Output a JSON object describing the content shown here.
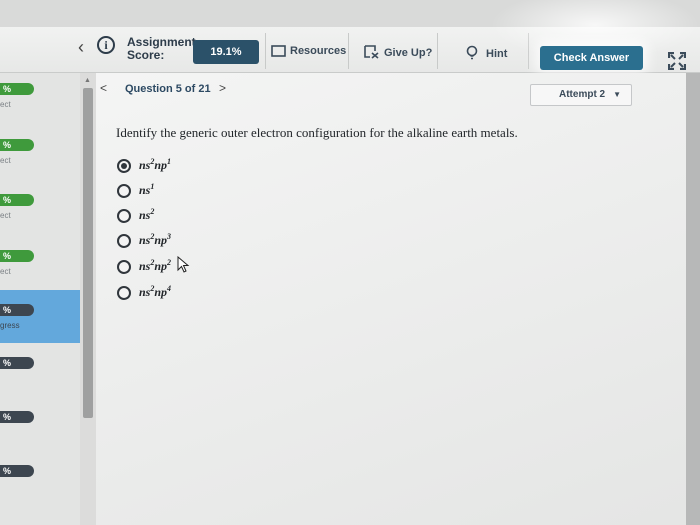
{
  "header": {
    "assignment_score_label": "Assignment Score:",
    "score_value": "19.1%",
    "resources_label": "Resources",
    "give_up_label": "Give Up?",
    "hint_label": "Hint",
    "check_answer_label": "Check Answer"
  },
  "sidebar": {
    "items": [
      {
        "pill": "%",
        "sub": "ect",
        "style": "green"
      },
      {
        "pill": "%",
        "sub": "ect",
        "style": "green"
      },
      {
        "pill": "%",
        "sub": "ect",
        "style": "green"
      },
      {
        "pill": "%",
        "sub": "ect",
        "style": "green"
      },
      {
        "pill": "%",
        "sub": "gress",
        "style": "dark"
      },
      {
        "pill": "%",
        "sub": "",
        "style": "dark"
      },
      {
        "pill": "%",
        "sub": "",
        "style": "dark"
      },
      {
        "pill": "%",
        "sub": "",
        "style": "dark"
      }
    ]
  },
  "question_nav": {
    "title": "Question 5 of 21",
    "prev_symbol": "<",
    "next_symbol": ">"
  },
  "attempt": {
    "label": "Attempt 2"
  },
  "question": {
    "prompt": "Identify the generic outer electron configuration for the alkaline earth metals.",
    "options": [
      {
        "base1": "ns",
        "sup1": "2",
        "base2": "np",
        "sup2": "1",
        "selected": true
      },
      {
        "base1": "ns",
        "sup1": "1",
        "base2": "",
        "sup2": "",
        "selected": false
      },
      {
        "base1": "ns",
        "sup1": "2",
        "base2": "",
        "sup2": "",
        "selected": false
      },
      {
        "base1": "ns",
        "sup1": "2",
        "base2": "np",
        "sup2": "3",
        "selected": false
      },
      {
        "base1": "ns",
        "sup1": "2",
        "base2": "np",
        "sup2": "2",
        "selected": false
      },
      {
        "base1": "ns",
        "sup1": "2",
        "base2": "np",
        "sup2": "4",
        "selected": false
      }
    ]
  },
  "colors": {
    "score_pill": "#2b5169",
    "check_answer": "#2b6f8f",
    "progress_green": "#3f9a3c",
    "sidebar_active": "#63a8dc"
  }
}
